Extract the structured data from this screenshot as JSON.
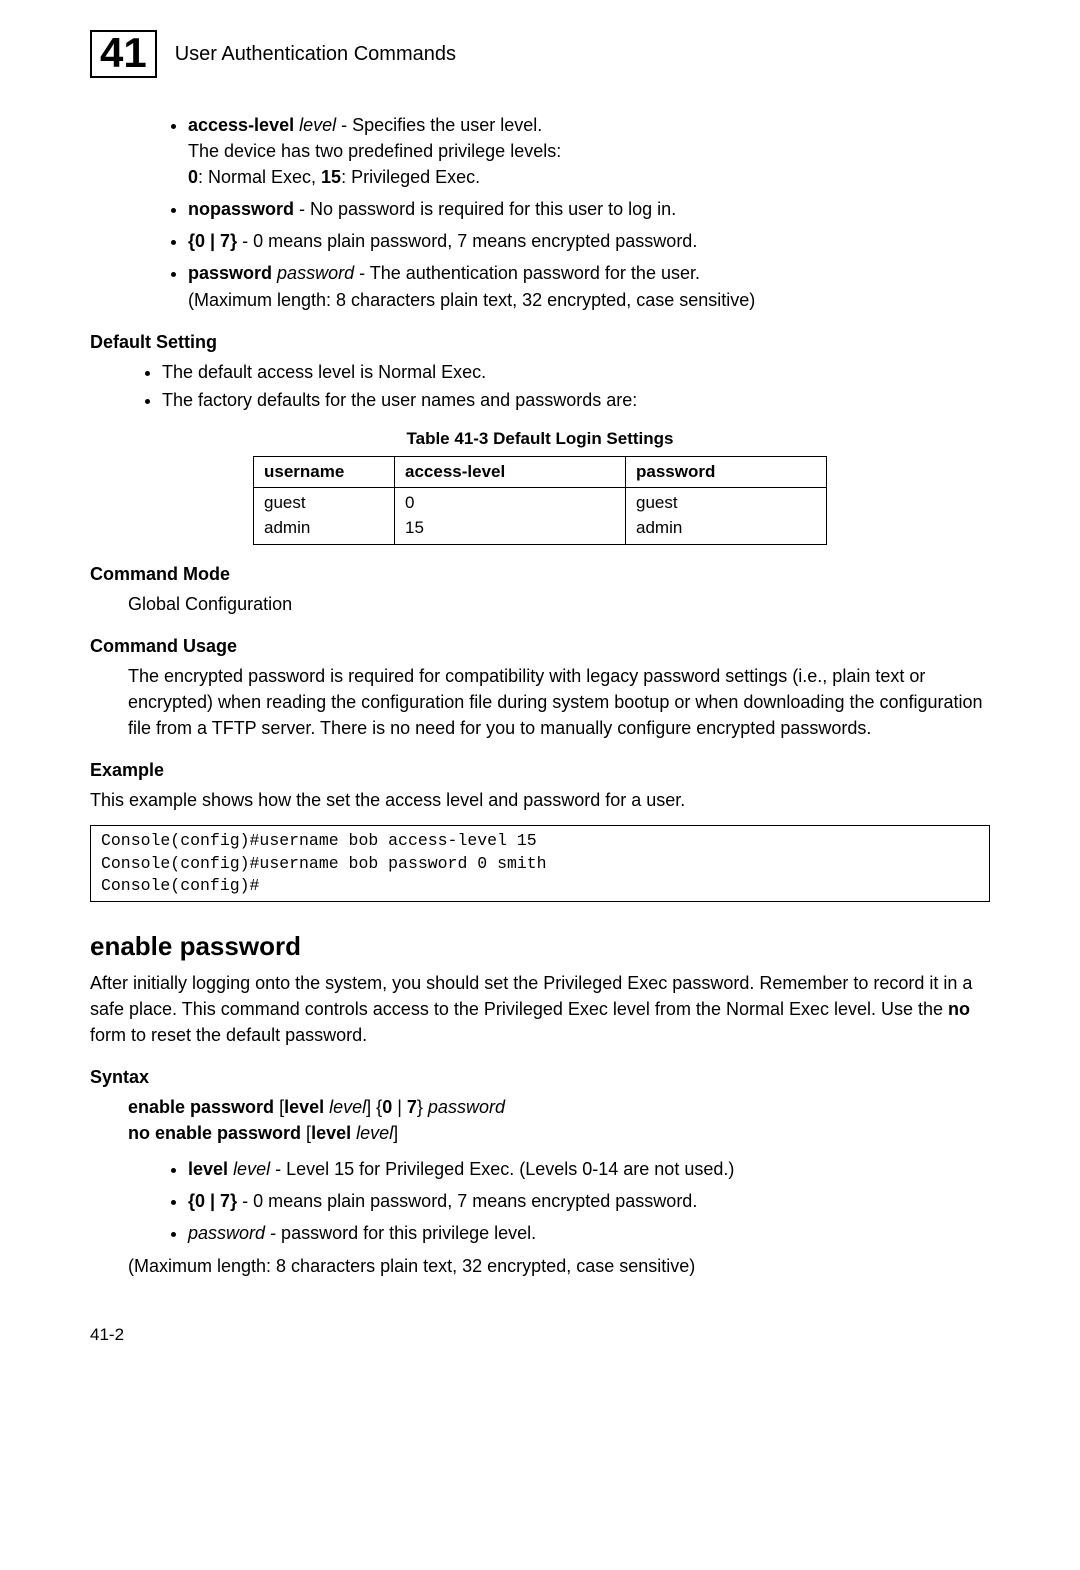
{
  "header": {
    "chapter_no": "41",
    "chapter_title": "User Authentication Commands"
  },
  "params": {
    "access_level_bold": "access-level",
    "access_level_ital": "level",
    "access_level_desc": " - Specifies the user level.",
    "access_level_sub1": "The device has two predefined privilege levels:",
    "access_level_sub2_a": "0",
    "access_level_sub2_b": ": Normal Exec, ",
    "access_level_sub2_c": "15",
    "access_level_sub2_d": ": Privileged Exec.",
    "nopassword_bold": "nopassword",
    "nopassword_desc": " - No password is required for this user to log in.",
    "zero7_bold": "{0 | 7}",
    "zero7_desc": " - 0 means plain password, 7 means encrypted password.",
    "password_bold": "password",
    "password_ital": "password",
    "password_desc": " - The authentication password for the user.",
    "password_sub": "(Maximum length: 8 characters plain text, 32 encrypted, case sensitive)"
  },
  "default_setting": {
    "head": "Default Setting",
    "item1": "The default access level is Normal Exec.",
    "item2": "The factory defaults for the user names and passwords are:"
  },
  "table": {
    "caption": "Table 41-3  Default Login Settings",
    "h1": "username",
    "h2": "access-level",
    "h3": "password",
    "c1a": "guest",
    "c1b": "admin",
    "c2a": "0",
    "c2b": "15",
    "c3a": "guest",
    "c3b": "admin"
  },
  "cmd_mode": {
    "head": "Command Mode",
    "text": "Global Configuration"
  },
  "cmd_usage": {
    "head": "Command Usage",
    "text": "The encrypted password is required for compatibility with legacy password settings (i.e., plain text or encrypted) when reading the configuration file during system bootup or when downloading the configuration file from a TFTP server. There is no need for you to manually configure encrypted passwords."
  },
  "example": {
    "head": "Example",
    "intro": "This example shows how the set the access level and password for a user.",
    "code": "Console(config)#username bob access-level 15\nConsole(config)#username bob password 0 smith\nConsole(config)#"
  },
  "enable": {
    "title": "enable password",
    "para_a": "After initially logging onto the system, you should set the Privileged Exec password. Remember to record it in a safe place. This command controls access to the Privileged Exec level from the Normal Exec level. Use the ",
    "para_bold": "no",
    "para_b": " form to reset the default password."
  },
  "syntax": {
    "head": "Syntax",
    "l1_a": "enable password",
    "l1_b": " [",
    "l1_c": "level",
    "l1_d": " ",
    "l1_e": "level",
    "l1_f": "] {",
    "l1_g": "0",
    "l1_h": " | ",
    "l1_i": "7",
    "l1_j": "} ",
    "l1_k": "password",
    "l2_a": "no enable password",
    "l2_b": " [",
    "l2_c": "level",
    "l2_d": " ",
    "l2_e": "level",
    "l2_f": "]",
    "b1_bold": "level",
    "b1_ital": "level",
    "b1_desc": " - Level 15 for Privileged Exec. (Levels 0-14 are not used.)",
    "b2_bold": "{0 | 7}",
    "b2_desc": " - 0 means plain password, 7 means encrypted password.",
    "b3_ital": "password",
    "b3_desc": " - password for this privilege level.",
    "maxlen": "(Maximum length: 8 characters plain text, 32 encrypted, case sensitive)"
  },
  "page_no": "41-2"
}
